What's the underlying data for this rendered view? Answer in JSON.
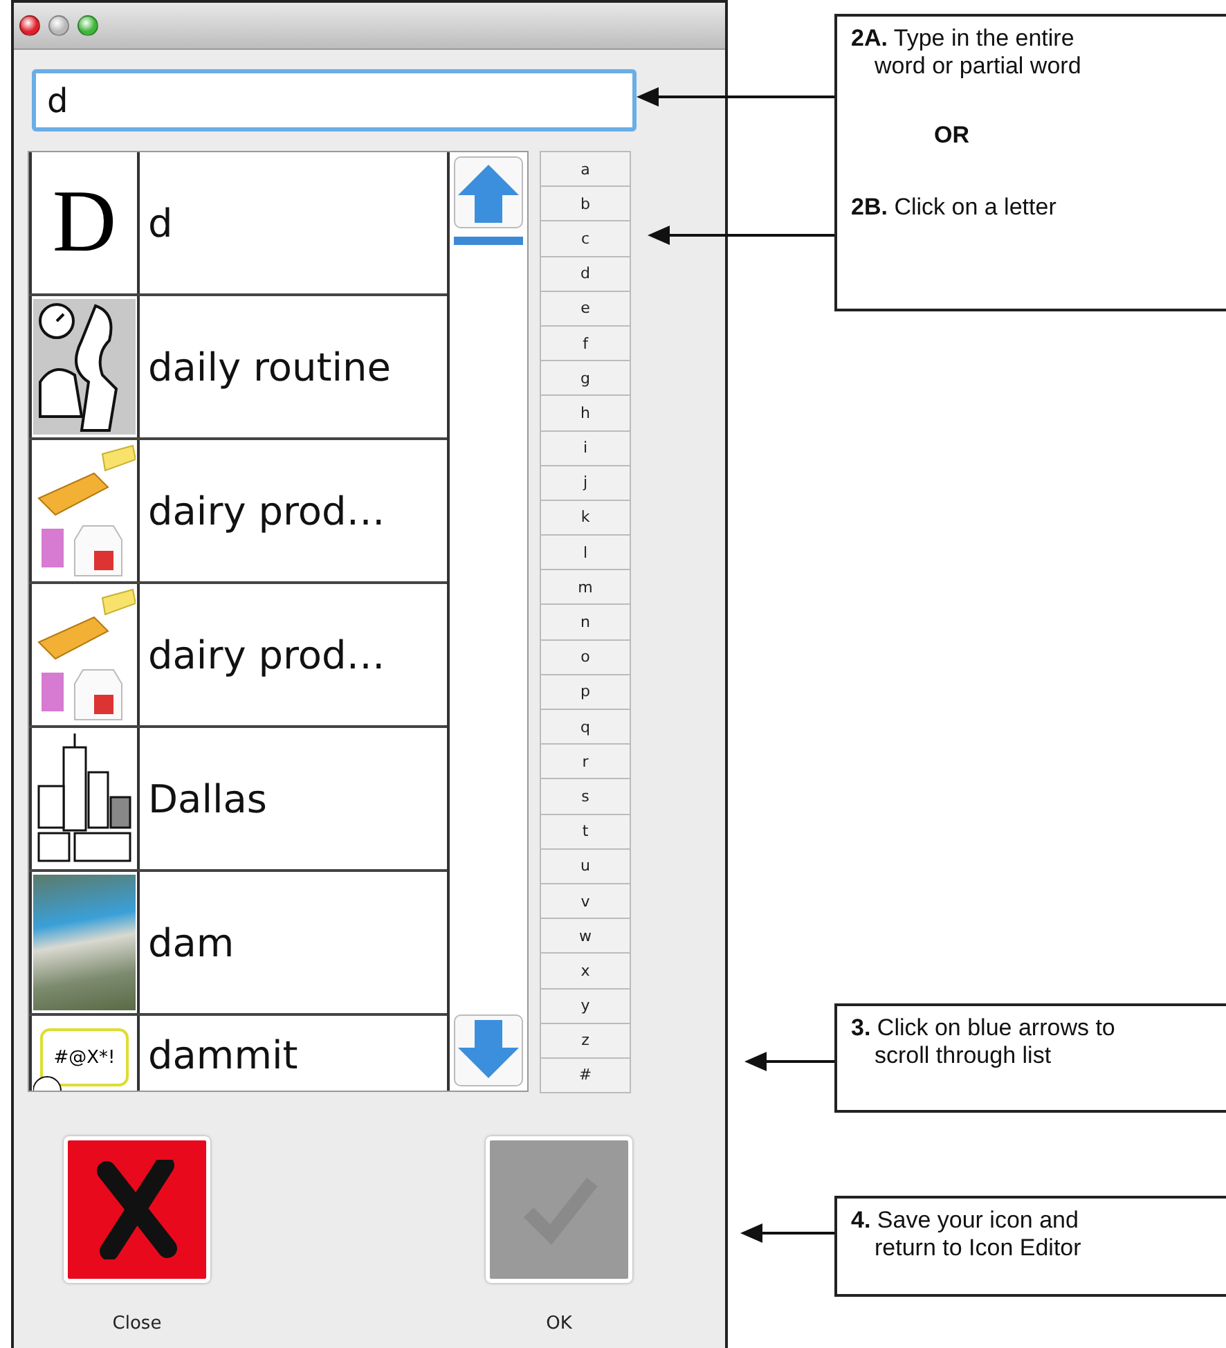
{
  "search": {
    "value": "d"
  },
  "results": [
    {
      "label": "d",
      "picture": {
        "kind": "letter",
        "symbol": "D"
      }
    },
    {
      "label": "daily routine",
      "picture": {
        "kind": "routine"
      }
    },
    {
      "label": "dairy prod…",
      "picture": {
        "kind": "dairy"
      }
    },
    {
      "label": "dairy prod…",
      "picture": {
        "kind": "dairy"
      }
    },
    {
      "label": "Dallas",
      "picture": {
        "kind": "city"
      }
    },
    {
      "label": "dam",
      "picture": {
        "kind": "photo"
      }
    },
    {
      "label": "dammit",
      "picture": {
        "kind": "speech",
        "symbol": "#@X*!"
      }
    }
  ],
  "letters": [
    "a",
    "b",
    "c",
    "d",
    "e",
    "f",
    "g",
    "h",
    "i",
    "j",
    "k",
    "l",
    "m",
    "n",
    "o",
    "p",
    "q",
    "r",
    "s",
    "t",
    "u",
    "v",
    "w",
    "x",
    "y",
    "z",
    "#"
  ],
  "buttons": [
    {
      "kind": "close",
      "label": "Close",
      "disabled": false
    },
    {
      "kind": "ok",
      "label": "OK",
      "disabled": true
    }
  ],
  "callouts": [
    {
      "items": [
        {
          "kind": "step",
          "text": "**2A.** Type in the entire word or partial word"
        },
        {
          "kind": "or",
          "text": "**OR**"
        },
        {
          "kind": "step",
          "text": "**2B.** Click on a letter"
        }
      ]
    },
    {
      "items": [
        {
          "kind": "step",
          "text": "**3.** Click on blue arrows to scroll through list"
        }
      ]
    },
    {
      "items": [
        {
          "kind": "step",
          "text": "**4.** Save your icon and return to Icon Editor"
        }
      ]
    }
  ]
}
